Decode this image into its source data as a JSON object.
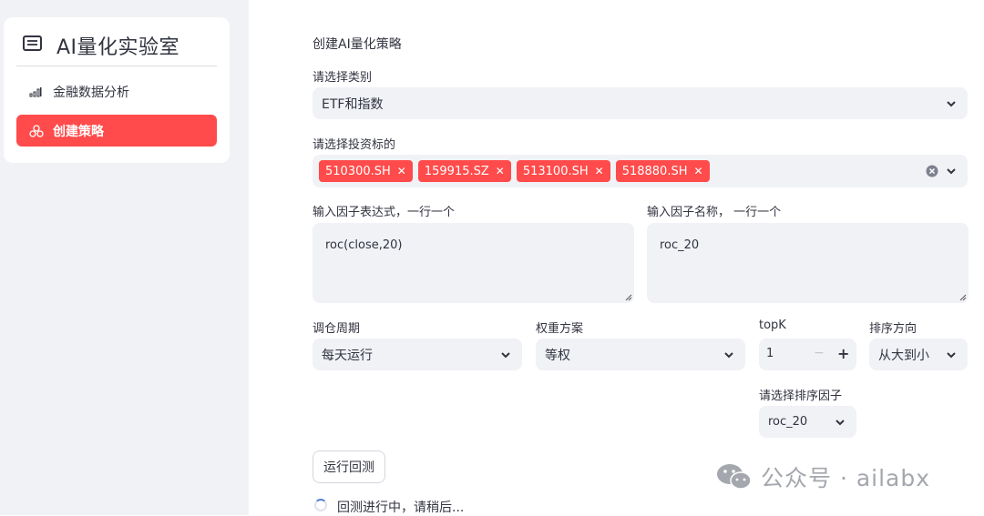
{
  "sidebar": {
    "app_title": "AI量化实验室",
    "items": [
      {
        "label": "金融数据分析",
        "icon": "bar-chart-icon",
        "active": false
      },
      {
        "label": "创建策略",
        "icon": "strategy-icon",
        "active": true
      }
    ]
  },
  "main": {
    "page_title": "创建AI量化策略",
    "category": {
      "label": "请选择类别",
      "value": "ETF和指数"
    },
    "targets": {
      "label": "请选择投资标的",
      "tags": [
        "510300.SH",
        "159915.SZ",
        "513100.SH",
        "518880.SH"
      ]
    },
    "factor_expr": {
      "label": "输入因子表达式，一行一个",
      "value": "roc(close,20)"
    },
    "factor_name": {
      "label": "输入因子名称， 一行一个",
      "value": "roc_20"
    },
    "rebalance": {
      "label": "调仓周期",
      "value": "每天运行"
    },
    "weighting": {
      "label": "权重方案",
      "value": "等权"
    },
    "topk": {
      "label": "topK",
      "value": "1",
      "minus": "−",
      "plus": "+"
    },
    "sort_dir": {
      "label": "排序方向",
      "value": "从大到小"
    },
    "sort_factor": {
      "label": "请选择排序因子",
      "value": "roc_20"
    },
    "run_button": "运行回测",
    "status": "回测进行中，请稍后..."
  },
  "watermark": {
    "text": "公众号 · ailabx"
  },
  "colors": {
    "accent": "#ff4b4b",
    "input_bg": "#f0f2f6",
    "sidebar_bg": "#f0f2f6"
  }
}
